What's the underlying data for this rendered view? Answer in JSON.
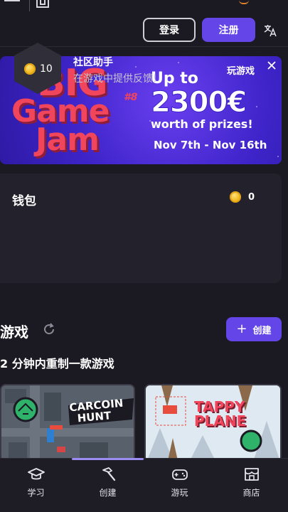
{
  "header": {
    "login_label": "登录",
    "register_label": "注册"
  },
  "banner": {
    "title_line1": "BIG",
    "title_line2": "Game",
    "title_line3": "Jam",
    "edition": "#8",
    "up_to": "Up to",
    "amount": "2300€",
    "worth": "worth of prizes!",
    "dates": "Nov 7th - Nov 16th"
  },
  "wallet": {
    "title": "钱包",
    "balance": "0",
    "task": {
      "reward": "10",
      "title": "社区助手",
      "subtitle": "在游戏中提供反馈!",
      "action": "玩游戏"
    }
  },
  "games": {
    "title": "游戏",
    "create_label": "创建",
    "subtitle": "2 分钟内重制一款游戏",
    "cards": [
      {
        "title_line1": "CARCOIN",
        "title_line2": "HUNT"
      },
      {
        "title_line1": "TAPPY",
        "title_line2": "PLANE"
      }
    ]
  },
  "nav": {
    "items": [
      {
        "label": "学习",
        "icon": "graduation-cap-icon"
      },
      {
        "label": "创建",
        "icon": "hammer-icon"
      },
      {
        "label": "游玩",
        "icon": "gamepad-icon"
      },
      {
        "label": "商店",
        "icon": "store-icon"
      }
    ],
    "active": "创建"
  },
  "colors": {
    "accent": "#6445e8",
    "background": "#1b1a22",
    "card": "#23222c",
    "banner": "#3e24c9",
    "banner_title": "#f0455a",
    "coin": "#f3b81f"
  }
}
